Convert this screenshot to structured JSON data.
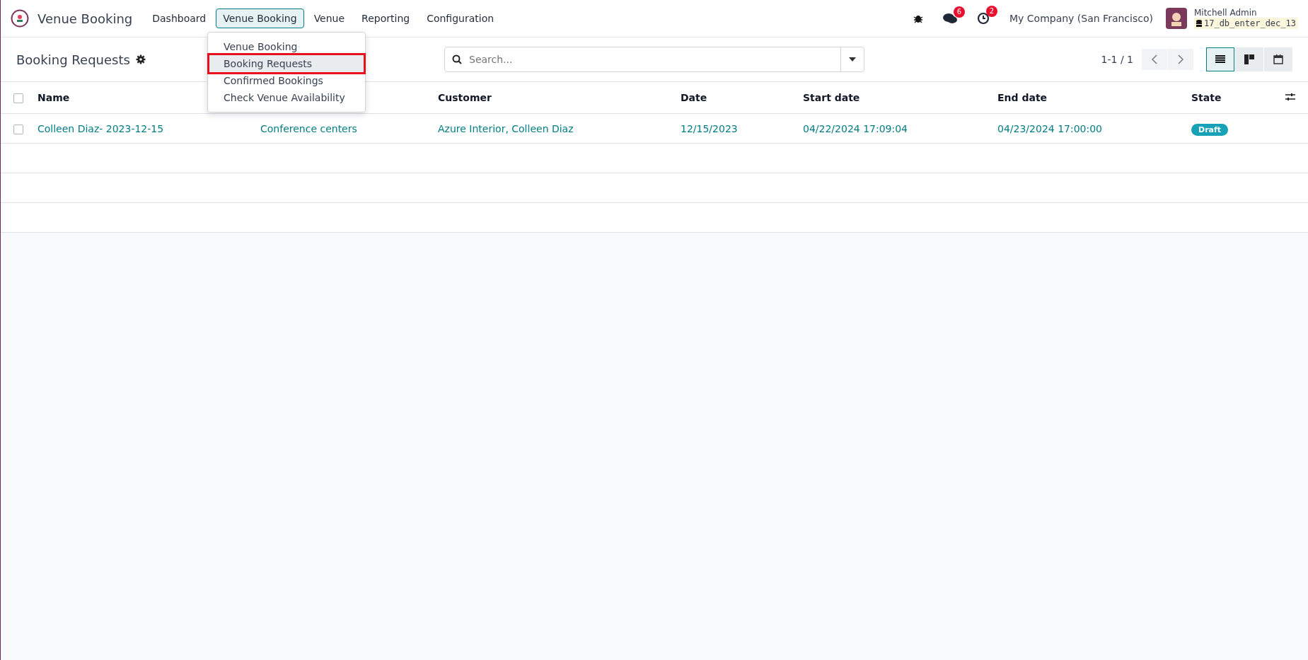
{
  "app": {
    "title": "Venue Booking"
  },
  "menu": [
    {
      "label": "Dashboard",
      "selected": false
    },
    {
      "label": "Venue Booking",
      "selected": true
    },
    {
      "label": "Venue",
      "selected": false
    },
    {
      "label": "Reporting",
      "selected": false
    },
    {
      "label": "Configuration",
      "selected": false
    }
  ],
  "dropdown": [
    {
      "label": "Venue Booking",
      "selected": false
    },
    {
      "label": "Booking Requests",
      "selected": true
    },
    {
      "label": "Confirmed Bookings",
      "selected": false
    },
    {
      "label": "Check Venue Availability",
      "selected": false
    }
  ],
  "systray": {
    "messages_count": "6",
    "activities_count": "2",
    "company": "My Company (San Francisco)",
    "user": "Mitchell Admin",
    "database": "17_db_enter_dec_13"
  },
  "control_panel": {
    "title": "Booking Requests",
    "search_placeholder": "Search...",
    "pager": "1-1 / 1",
    "views": [
      {
        "kind": "list",
        "selected": true
      },
      {
        "kind": "kanban",
        "selected": false
      },
      {
        "kind": "calendar",
        "selected": false
      }
    ]
  },
  "table": {
    "select_all_checked": false,
    "columns": [
      "Name",
      "",
      "Customer",
      "Date",
      "Start date",
      "End date",
      "State"
    ],
    "rows": [
      {
        "checked": false,
        "cells": [
          "Colleen Diaz- 2023-12-15",
          "Conference centers",
          "Azure Interior, Colleen Diaz",
          "12/15/2023",
          "04/22/2024 17:09:04",
          "04/23/2024 17:00:00"
        ],
        "state": "Draft"
      }
    ]
  }
}
